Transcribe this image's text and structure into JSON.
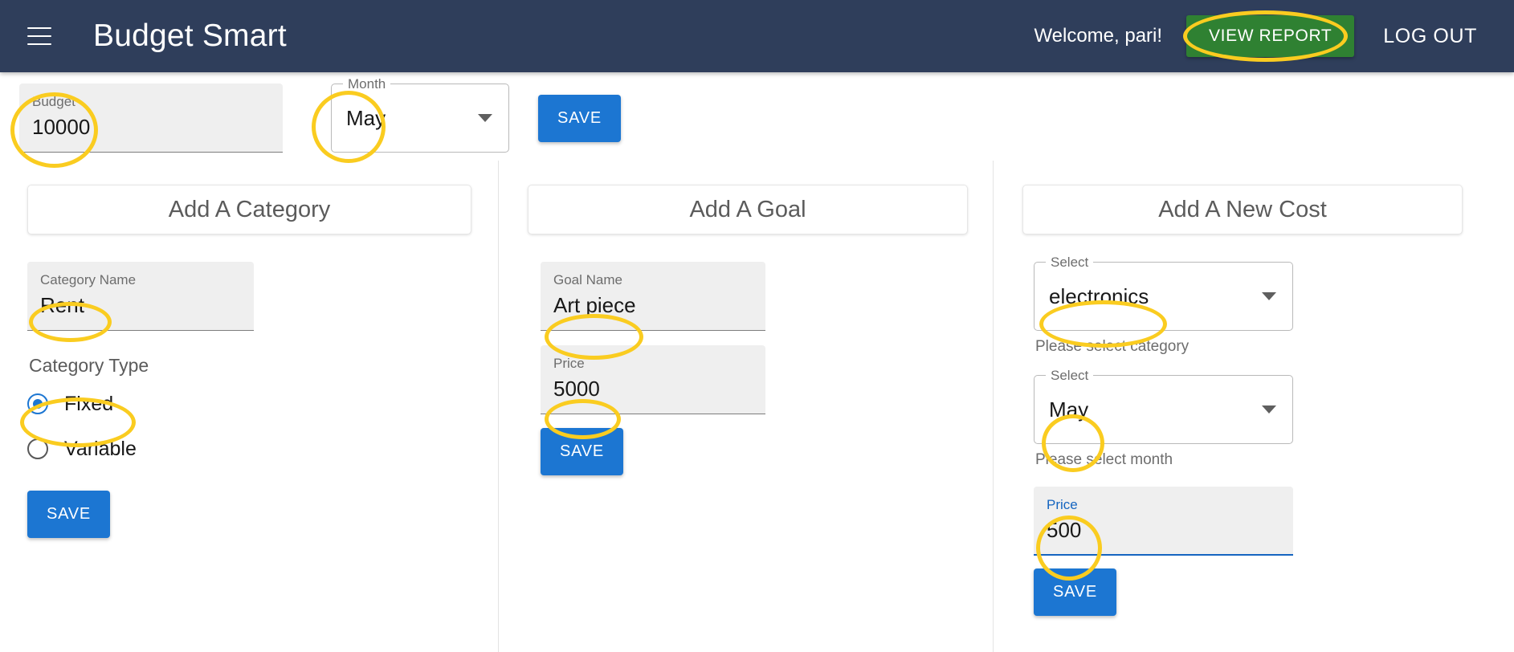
{
  "header": {
    "menu_icon": "hamburger-menu-icon",
    "title": "Budget Smart",
    "welcome": "Welcome, pari!",
    "view_report_label": "VIEW REPORT",
    "logout_label": "LOG OUT",
    "bar_color": "#2f3e5b",
    "view_report_color": "#2f8132"
  },
  "budget_row": {
    "budget_field": {
      "label": "Budget",
      "value": "10000"
    },
    "month_select": {
      "label": "Month",
      "value": "May"
    },
    "save_label": "SAVE"
  },
  "category_panel": {
    "title": "Add A Category",
    "name_field": {
      "label": "Category Name",
      "value": "Rent"
    },
    "type_label": "Category Type",
    "options": [
      {
        "label": "Fixed",
        "selected": true
      },
      {
        "label": "Variable",
        "selected": false
      }
    ],
    "save_label": "SAVE"
  },
  "goal_panel": {
    "title": "Add A Goal",
    "name_field": {
      "label": "Goal Name",
      "value": "Art piece"
    },
    "price_field": {
      "label": "Price",
      "value": "5000"
    },
    "save_label": "SAVE"
  },
  "cost_panel": {
    "title": "Add A New Cost",
    "category_select": {
      "label": "Select",
      "value": "electronics",
      "helper": "Please select category"
    },
    "month_select": {
      "label": "Select",
      "value": "May",
      "helper": "Please select month"
    },
    "price_field": {
      "label": "Price",
      "value": "500"
    },
    "save_label": "SAVE"
  },
  "annotation": {
    "color": "#facc20"
  }
}
